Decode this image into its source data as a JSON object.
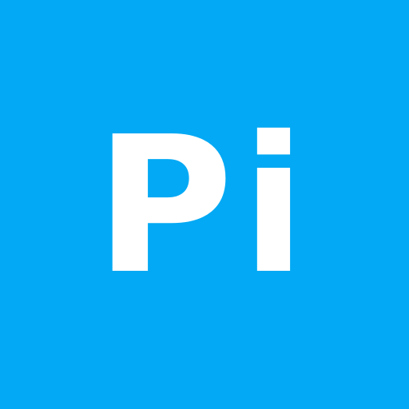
{
  "avatar": {
    "initials": "Pi",
    "background_color": "#03a9f4",
    "text_color": "#ffffff"
  }
}
